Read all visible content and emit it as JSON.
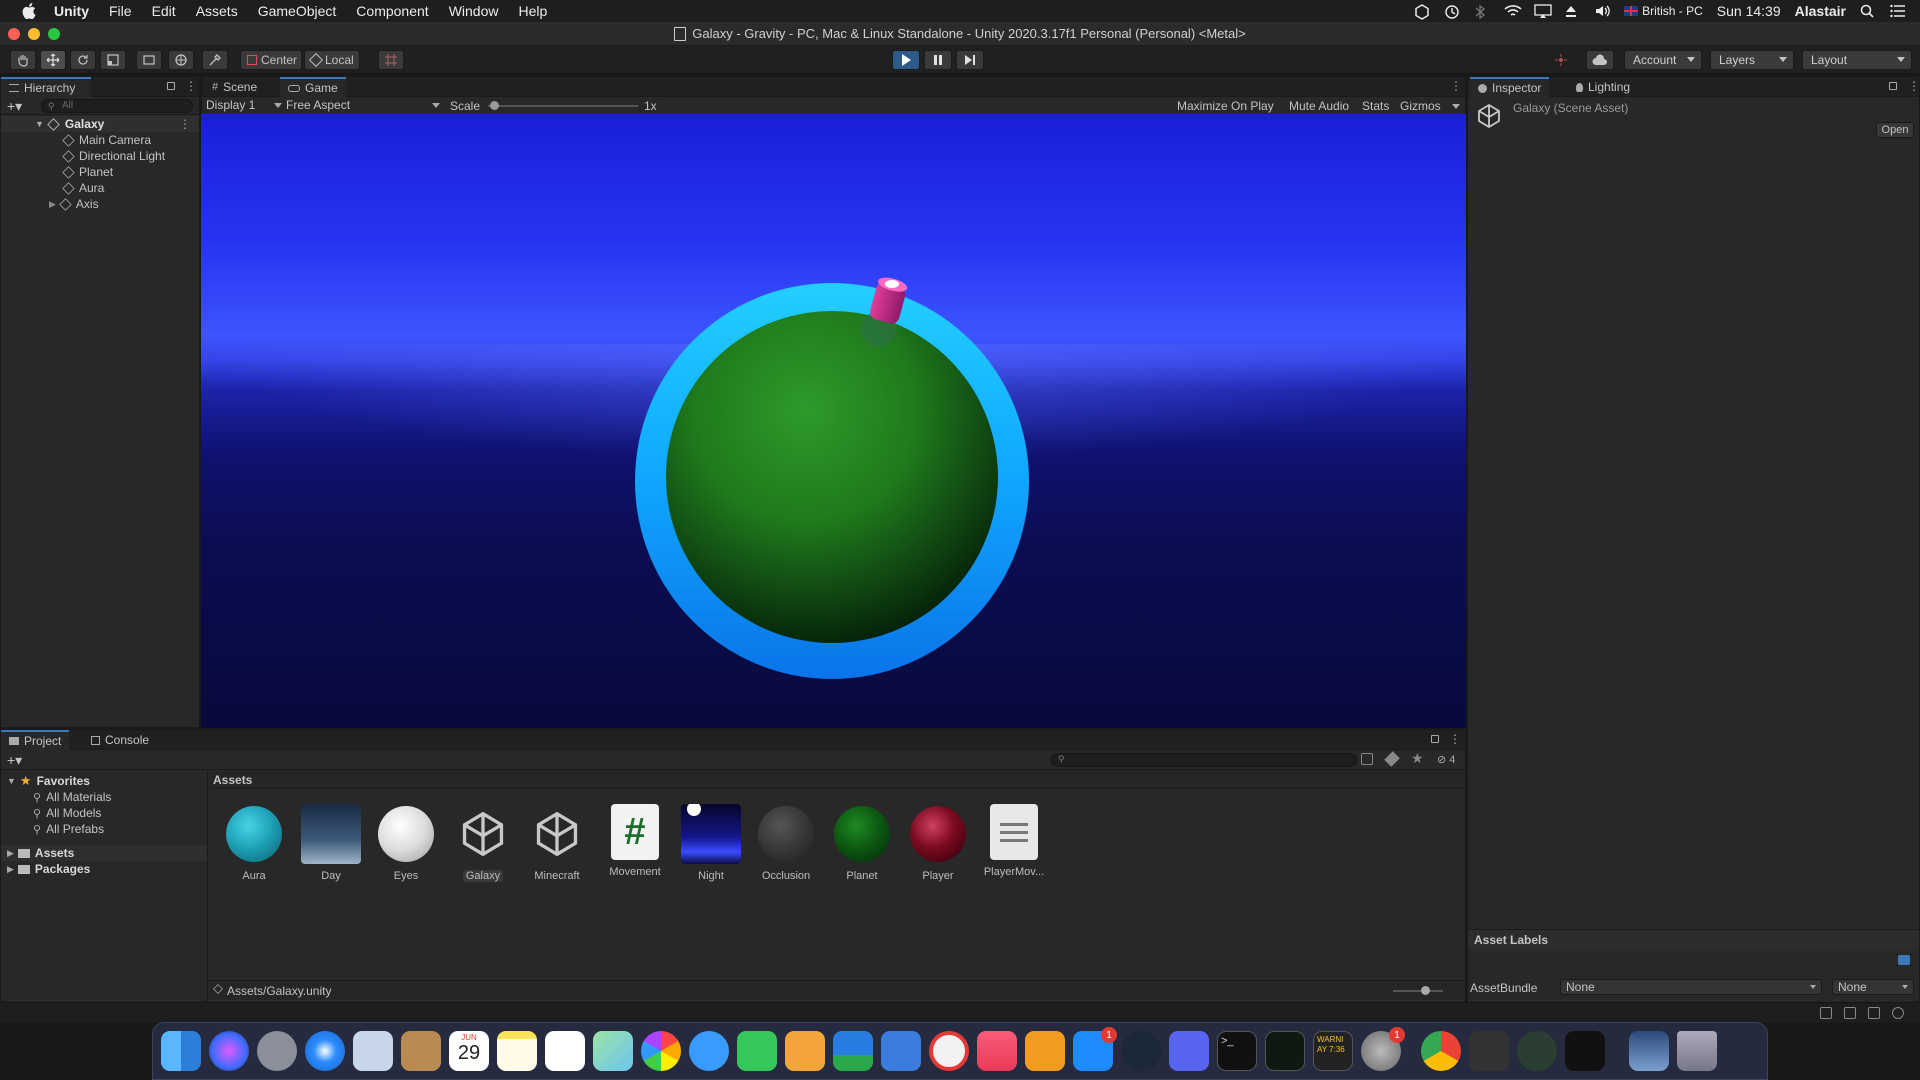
{
  "menubar": {
    "app_name": "Unity",
    "items": [
      "File",
      "Edit",
      "Assets",
      "GameObject",
      "Component",
      "Window",
      "Help"
    ],
    "input_source": "British - PC",
    "clock": "Sun 14:39",
    "user": "Alastair"
  },
  "window": {
    "title": "Galaxy - Gravity - PC, Mac & Linux Standalone - Unity 2020.3.17f1 Personal (Personal) <Metal>"
  },
  "toolbar": {
    "pivot_label": "Center",
    "space_label": "Local",
    "account_label": "Account",
    "layers_label": "Layers",
    "layout_label": "Layout"
  },
  "hierarchy": {
    "tab_label": "Hierarchy",
    "search_placeholder": "All",
    "scene_name": "Galaxy",
    "items": [
      "Main Camera",
      "Directional Light",
      "Planet",
      "Aura",
      "Axis"
    ]
  },
  "game_view": {
    "tabs": [
      "Scene",
      "Game"
    ],
    "display": "Display 1",
    "aspect": "Free Aspect",
    "scale_label": "Scale",
    "scale_value": "1x",
    "maximize": "Maximize On Play",
    "mute": "Mute Audio",
    "stats": "Stats",
    "gizmos": "Gizmos"
  },
  "inspector": {
    "tabs": [
      "Inspector",
      "Lighting"
    ],
    "asset_title": "Galaxy (Scene Asset)",
    "open_label": "Open",
    "asset_labels_title": "Asset Labels",
    "assetbundle_label": "AssetBundle",
    "assetbundle_value": "None",
    "variant_value": "None"
  },
  "project": {
    "tabs": [
      "Project",
      "Console"
    ],
    "favorites_label": "Favorites",
    "favorites": [
      "All Materials",
      "All Models",
      "All Prefabs"
    ],
    "roots": [
      "Assets",
      "Packages"
    ],
    "breadcrumb": "Assets",
    "hidden_count": "4",
    "path": "Assets/Galaxy.unity",
    "assets": [
      {
        "name": "Aura",
        "kind": "material-sphere",
        "color": "#1fa3b8"
      },
      {
        "name": "Day",
        "kind": "skybox",
        "color": "#3c5a7a"
      },
      {
        "name": "Eyes",
        "kind": "material-sphere",
        "color": "#d8d8d8"
      },
      {
        "name": "Galaxy",
        "kind": "unity-scene",
        "color": "#c8c8c8"
      },
      {
        "name": "Minecraft",
        "kind": "unity-scene",
        "color": "#c8c8c8"
      },
      {
        "name": "Movement",
        "kind": "script-hash",
        "color": "#1e6e2e"
      },
      {
        "name": "Night",
        "kind": "skybox",
        "color": "#14168a"
      },
      {
        "name": "Occlusion",
        "kind": "material-sphere",
        "color": "#3a3a3a"
      },
      {
        "name": "Planet",
        "kind": "material-sphere",
        "color": "#0d5a12"
      },
      {
        "name": "Player",
        "kind": "material-sphere",
        "color": "#7a0a1e"
      },
      {
        "name": "PlayerMov...",
        "kind": "text-document",
        "color": "#d8d8d8"
      }
    ]
  },
  "dock": {
    "calendar_month": "JUN",
    "calendar_day": "29",
    "appstore_badge": "1",
    "settings_badge": "1",
    "console_text": "WARNI\nAY 7:36"
  }
}
